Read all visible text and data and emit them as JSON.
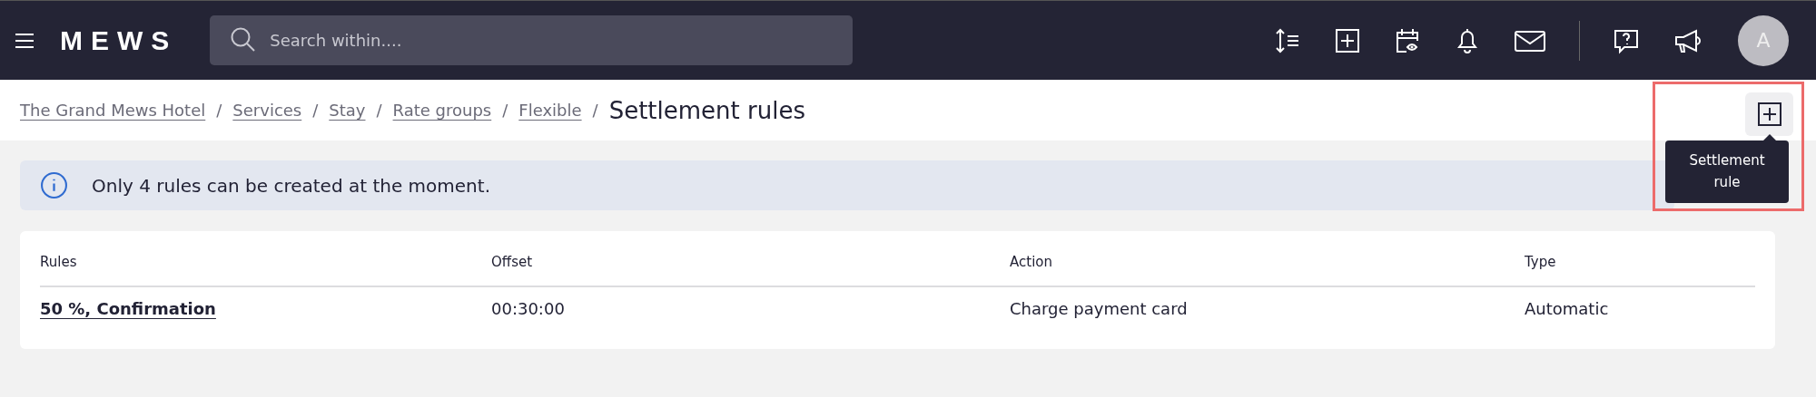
{
  "header": {
    "logo": "MEWS",
    "search": {
      "placeholder": "Search within...."
    },
    "avatar": "A"
  },
  "breadcrumbs": [
    {
      "label": "The Grand Mews Hotel"
    },
    {
      "label": "Services"
    },
    {
      "label": "Stay"
    },
    {
      "label": "Rate groups"
    },
    {
      "label": "Flexible"
    }
  ],
  "breadcrumb_separator": "/",
  "page_title": "Settlement rules",
  "add_button": {
    "tooltip": "Settlement rule",
    "highlighted": true
  },
  "info_banner": "Only 4 rules can be created at the moment.",
  "table": {
    "columns": [
      "Rules",
      "Offset",
      "Action",
      "Type"
    ],
    "rows": [
      {
        "cells": [
          "50 %, Confirmation",
          "00:30:00",
          "Charge payment card",
          "Automatic"
        ]
      }
    ]
  }
}
